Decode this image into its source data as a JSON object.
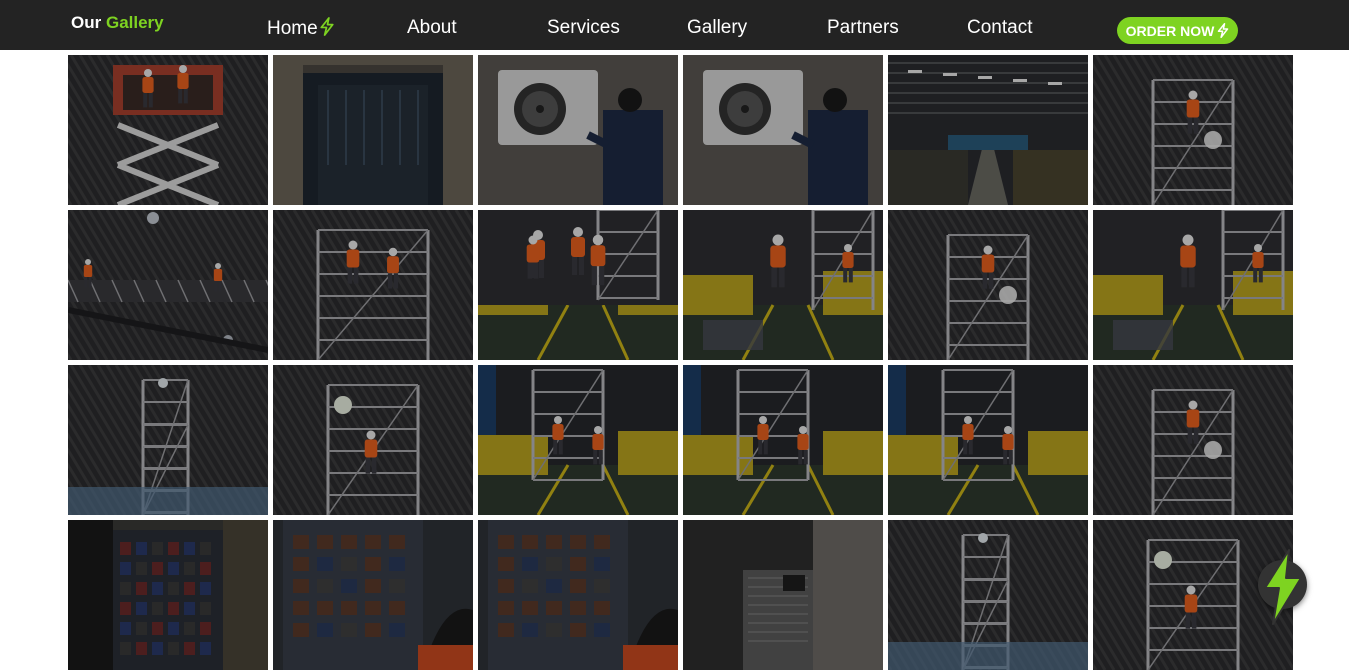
{
  "brand": {
    "first": "Our",
    "second": "Gallery"
  },
  "nav": [
    {
      "label": "Home",
      "icon": "bolt-icon"
    },
    {
      "label": "About"
    },
    {
      "label": "Services"
    },
    {
      "label": "Gallery"
    },
    {
      "label": "Partners"
    },
    {
      "label": "Contact"
    }
  ],
  "order_button": {
    "label": "ORDER NOW",
    "icon": "bolt-icon"
  },
  "floating_button": {
    "icon": "bolt-icon"
  },
  "colors": {
    "navbar": "#232323",
    "accent": "#7ed321",
    "text": "#ffffff"
  },
  "gallery": {
    "photos": [
      {
        "scene": "scissor-lift"
      },
      {
        "scene": "warehouse-door"
      },
      {
        "scene": "ac-unit-technician"
      },
      {
        "scene": "ac-unit-technician"
      },
      {
        "scene": "warehouse-hall"
      },
      {
        "scene": "scaffold-climber"
      },
      {
        "scene": "roof-platform"
      },
      {
        "scene": "scaffold-workers"
      },
      {
        "scene": "team-generators"
      },
      {
        "scene": "worker-generators"
      },
      {
        "scene": "scaffold-climber"
      },
      {
        "scene": "worker-generators"
      },
      {
        "scene": "scaffold-tower"
      },
      {
        "scene": "scaffold-worker"
      },
      {
        "scene": "scaffold-generators"
      },
      {
        "scene": "scaffold-generators"
      },
      {
        "scene": "scaffold-generators"
      },
      {
        "scene": "scaffold-climber"
      },
      {
        "scene": "electrical-panel"
      },
      {
        "scene": "panel-technician"
      },
      {
        "scene": "panel-technician"
      },
      {
        "scene": "ac-cabinet"
      },
      {
        "scene": "scaffold-tower"
      },
      {
        "scene": "scaffold-worker"
      }
    ]
  }
}
